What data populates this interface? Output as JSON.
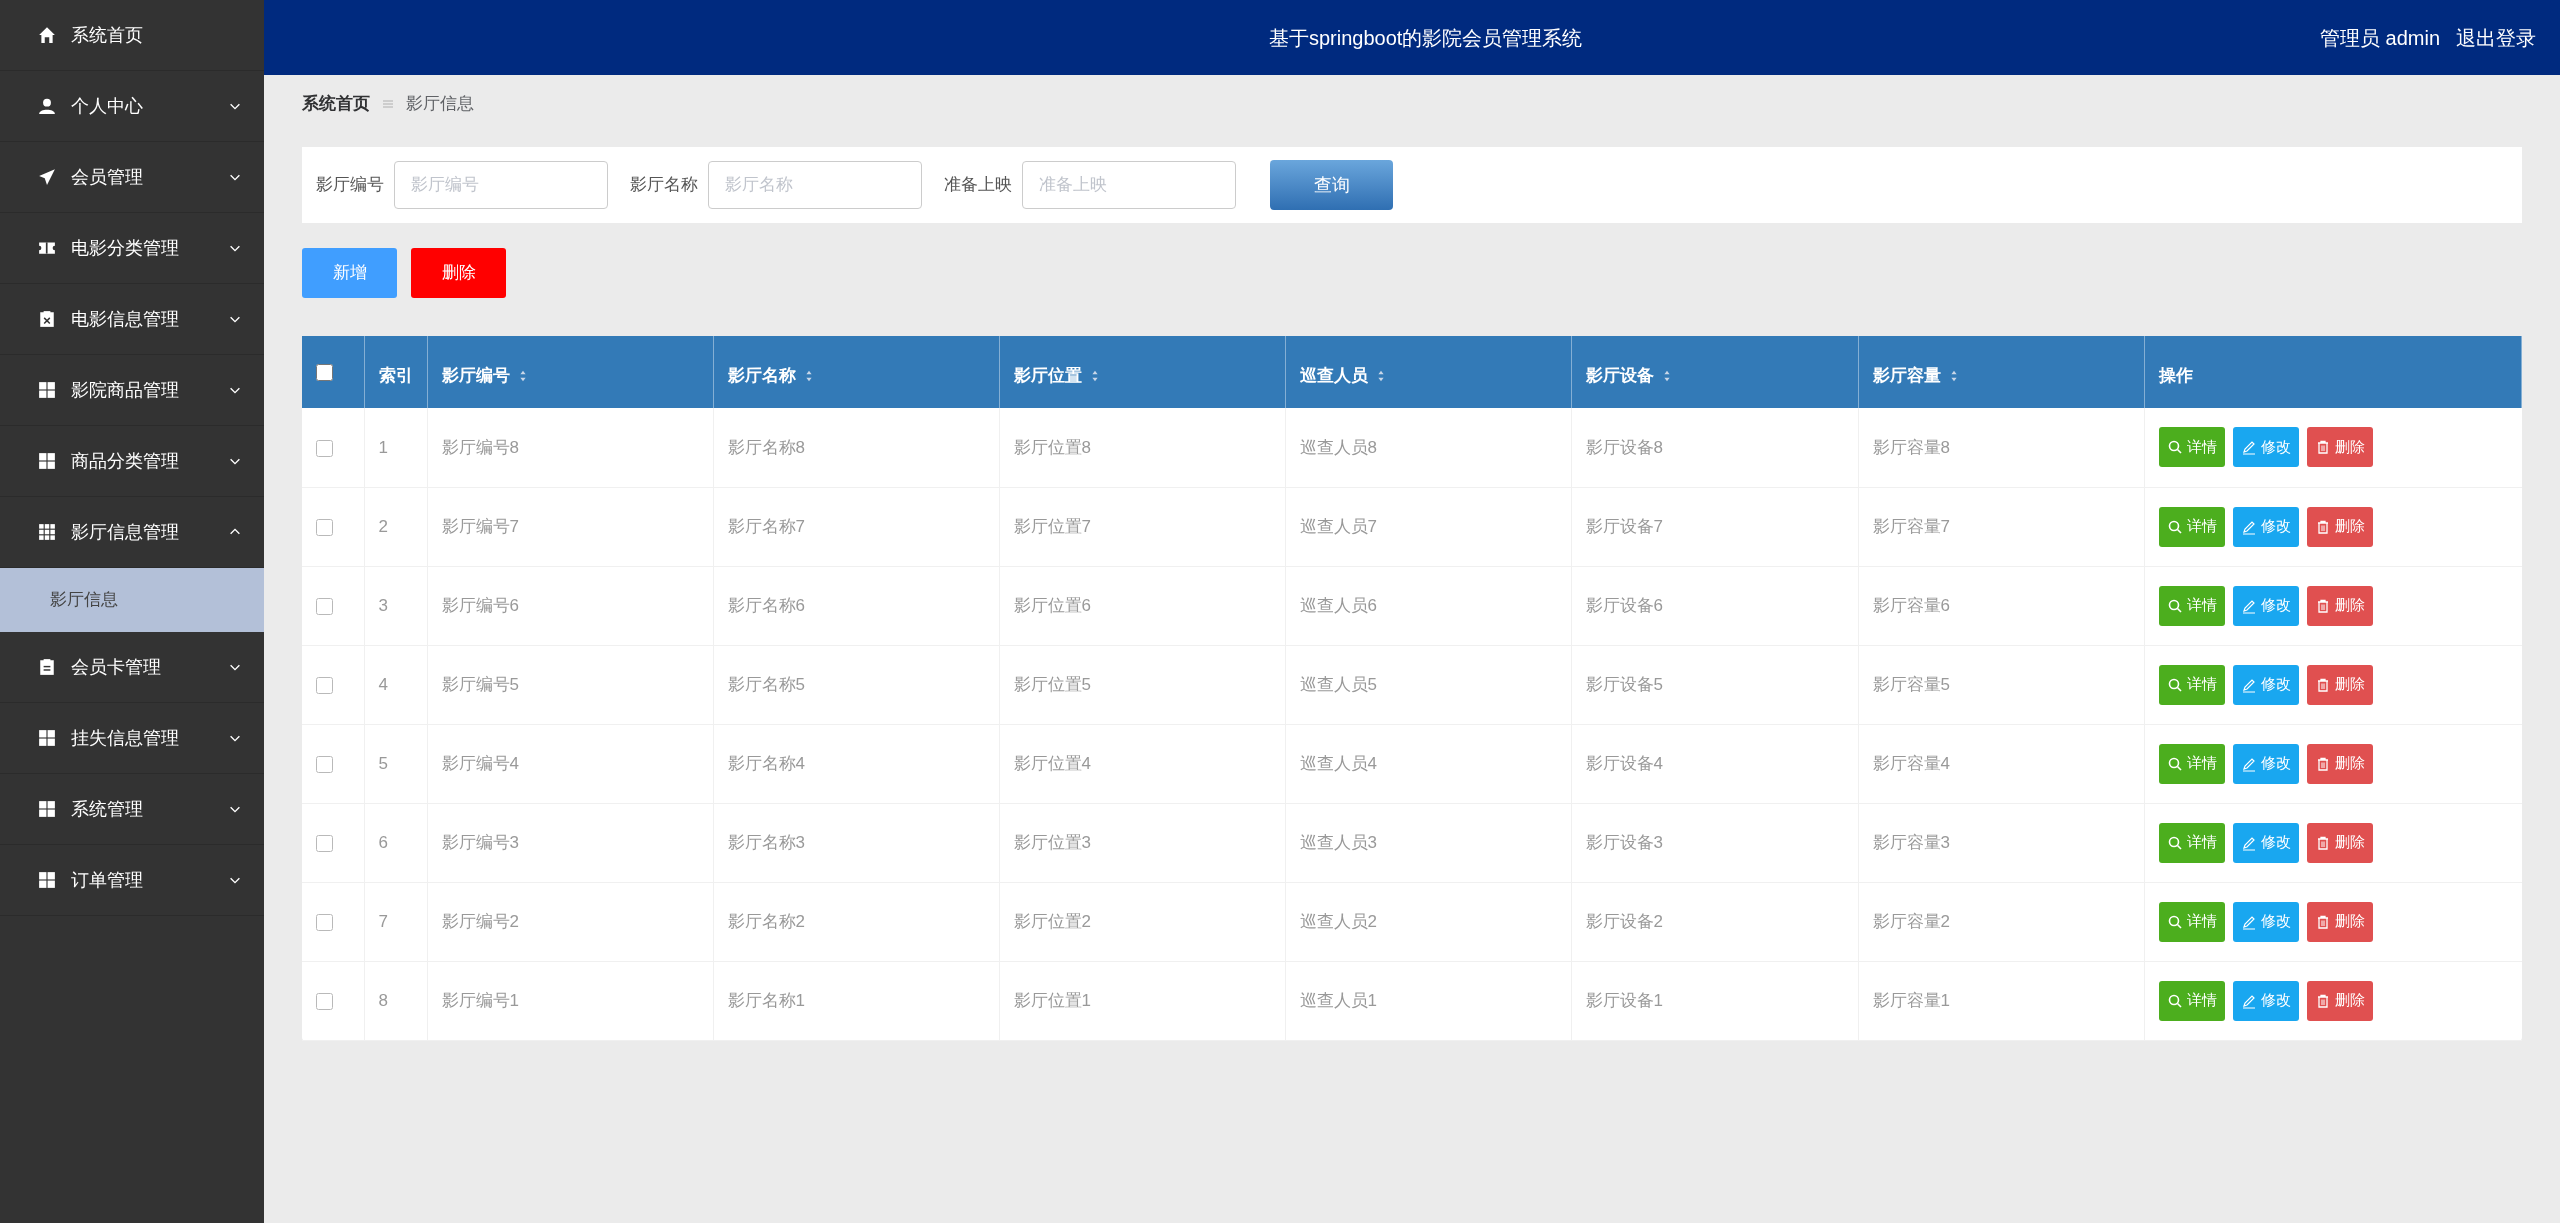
{
  "header": {
    "title": "基于springboot的影院会员管理系统",
    "user": "管理员 admin",
    "logout": "退出登录"
  },
  "sidebar": {
    "items": [
      {
        "kind": "link",
        "label": "系统首页"
      },
      {
        "kind": "menu",
        "label": "个人中心",
        "expanded": false
      },
      {
        "kind": "menu",
        "label": "会员管理",
        "expanded": false
      },
      {
        "kind": "menu",
        "label": "电影分类管理",
        "expanded": false
      },
      {
        "kind": "menu",
        "label": "电影信息管理",
        "expanded": false
      },
      {
        "kind": "menu",
        "label": "影院商品管理",
        "expanded": false
      },
      {
        "kind": "menu",
        "label": "商品分类管理",
        "expanded": false
      },
      {
        "kind": "menu",
        "label": "影厅信息管理",
        "expanded": true,
        "children": [
          {
            "label": "影厅信息",
            "selected": true
          }
        ]
      },
      {
        "kind": "menu",
        "label": "会员卡管理",
        "expanded": false
      },
      {
        "kind": "menu",
        "label": "挂失信息管理",
        "expanded": false
      },
      {
        "kind": "menu",
        "label": "系统管理",
        "expanded": false
      },
      {
        "kind": "menu",
        "label": "订单管理",
        "expanded": false
      }
    ]
  },
  "breadcrumb": [
    "系统首页",
    "影厅信息"
  ],
  "search": {
    "fields": [
      {
        "label": "影厅编号",
        "placeholder": "影厅编号"
      },
      {
        "label": "影厅名称",
        "placeholder": "影厅名称"
      },
      {
        "label": "准备上映",
        "placeholder": "准备上映"
      }
    ],
    "button": "查询"
  },
  "actions": [
    "新增",
    "删除"
  ],
  "table": {
    "select_all_checked": false,
    "columns": [
      {
        "label": "索引",
        "sortable": false
      },
      {
        "label": "影厅编号",
        "sortable": true
      },
      {
        "label": "影厅名称",
        "sortable": true
      },
      {
        "label": "影厅位置",
        "sortable": true
      },
      {
        "label": "巡查人员",
        "sortable": true
      },
      {
        "label": "影厅设备",
        "sortable": true
      },
      {
        "label": "影厅容量",
        "sortable": true
      },
      {
        "label": "操作",
        "sortable": false
      }
    ],
    "rows": [
      {
        "checked": false,
        "cells": [
          "1",
          "影厅编号8",
          "影厅名称8",
          "影厅位置8",
          "巡查人员8",
          "影厅设备8",
          "影厅容量8"
        ],
        "actions": [
          "详情",
          "修改",
          "删除"
        ]
      },
      {
        "checked": false,
        "cells": [
          "2",
          "影厅编号7",
          "影厅名称7",
          "影厅位置7",
          "巡查人员7",
          "影厅设备7",
          "影厅容量7"
        ],
        "actions": [
          "详情",
          "修改",
          "删除"
        ]
      },
      {
        "checked": false,
        "cells": [
          "3",
          "影厅编号6",
          "影厅名称6",
          "影厅位置6",
          "巡查人员6",
          "影厅设备6",
          "影厅容量6"
        ],
        "actions": [
          "详情",
          "修改",
          "删除"
        ]
      },
      {
        "checked": false,
        "cells": [
          "4",
          "影厅编号5",
          "影厅名称5",
          "影厅位置5",
          "巡查人员5",
          "影厅设备5",
          "影厅容量5"
        ],
        "actions": [
          "详情",
          "修改",
          "删除"
        ]
      },
      {
        "checked": false,
        "cells": [
          "5",
          "影厅编号4",
          "影厅名称4",
          "影厅位置4",
          "巡查人员4",
          "影厅设备4",
          "影厅容量4"
        ],
        "actions": [
          "详情",
          "修改",
          "删除"
        ]
      },
      {
        "checked": false,
        "cells": [
          "6",
          "影厅编号3",
          "影厅名称3",
          "影厅位置3",
          "巡查人员3",
          "影厅设备3",
          "影厅容量3"
        ],
        "actions": [
          "详情",
          "修改",
          "删除"
        ]
      },
      {
        "checked": false,
        "cells": [
          "7",
          "影厅编号2",
          "影厅名称2",
          "影厅位置2",
          "巡查人员2",
          "影厅设备2",
          "影厅容量2"
        ],
        "actions": [
          "详情",
          "修改",
          "删除"
        ]
      },
      {
        "checked": false,
        "cells": [
          "8",
          "影厅编号1",
          "影厅名称1",
          "影厅位置1",
          "巡查人员1",
          "影厅设备1",
          "影厅容量1"
        ],
        "actions": [
          "详情",
          "修改",
          "删除"
        ]
      }
    ]
  }
}
